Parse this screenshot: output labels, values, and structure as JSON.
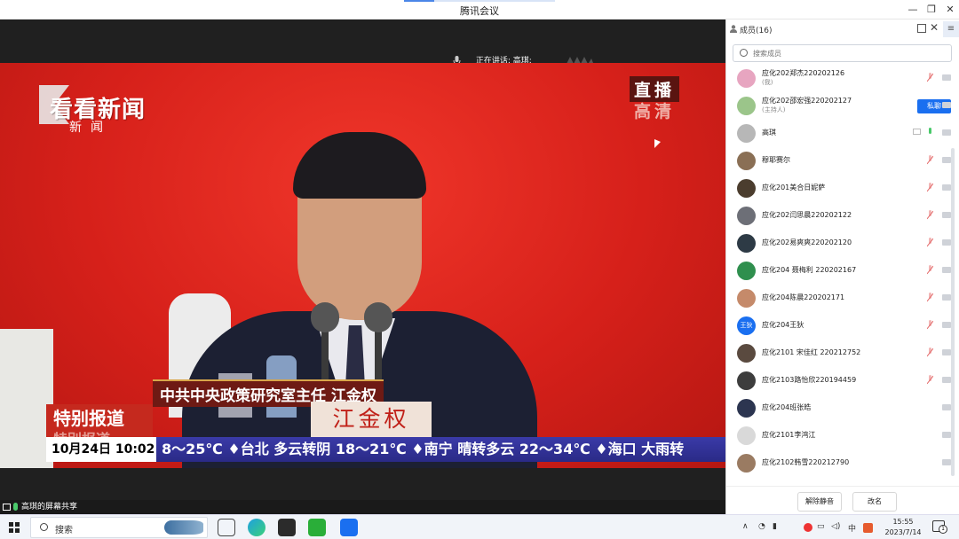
{
  "window": {
    "title": "腾讯会议"
  },
  "video": {
    "speaking_text": "正在讲话: 高琪;",
    "screen_share_label": "高琪的屏幕共享"
  },
  "broadcast": {
    "logo_main": "看看新闻",
    "logo_sub": "新闻",
    "live_label": "直播",
    "hd_label": "高清",
    "caption": "中共中央政策研究室主任 江金权",
    "special_report": "特别报道",
    "special_report_shadow": "特别报道",
    "nameplate": "江金权",
    "ticker_date": "10月24日 10:02",
    "ticker_text": "8～25℃ ♦台北 多云转阴 18～21℃ ♦南宁 晴转多云 22～34℃ ♦海口 大雨转"
  },
  "members_panel": {
    "title": "成员(16)",
    "search_placeholder": "搜索成员",
    "private_chat_label": "私聊",
    "members": [
      {
        "name": "应化202郑杰220202126",
        "role": "(我)",
        "avatar_color": "#e7a5c0",
        "avatar_text": "",
        "mic": "muted",
        "share": false
      },
      {
        "name": "应化202邵宏强220202127",
        "role": "(主持人)",
        "avatar_color": "#9bc58a",
        "avatar_text": "",
        "mic": "none",
        "share": false,
        "private_chat": true
      },
      {
        "name": "高琪",
        "role": "",
        "avatar_color": "#b7b7b7",
        "avatar_text": "",
        "mic": "active",
        "share": true
      },
      {
        "name": "穆耶赛尔",
        "role": "",
        "avatar_color": "#8a6f55",
        "avatar_text": "",
        "mic": "muted",
        "share": false
      },
      {
        "name": "应化201美合日妮萨",
        "role": "",
        "avatar_color": "#4b3d2e",
        "avatar_text": "",
        "mic": "muted",
        "share": false
      },
      {
        "name": "应化202闫思晨220202122",
        "role": "",
        "avatar_color": "#6d6f77",
        "avatar_text": "",
        "mic": "muted",
        "share": false
      },
      {
        "name": "应化202易爽爽220202120",
        "role": "",
        "avatar_color": "#2d3a45",
        "avatar_text": "",
        "mic": "muted",
        "share": false
      },
      {
        "name": "应化204 聂梅利 220202167",
        "role": "",
        "avatar_color": "#2f8f4e",
        "avatar_text": "",
        "mic": "muted",
        "share": false
      },
      {
        "name": "应化204陈晨220202171",
        "role": "",
        "avatar_color": "#c58a6a",
        "avatar_text": "",
        "mic": "muted",
        "share": false
      },
      {
        "name": "应化204王狄",
        "role": "",
        "avatar_color": "#1a6ff0",
        "avatar_text": "王狄",
        "mic": "muted",
        "share": false
      },
      {
        "name": "应化2101 宋佳红 220212752",
        "role": "",
        "avatar_color": "#5a4a3f",
        "avatar_text": "",
        "mic": "muted",
        "share": false
      },
      {
        "name": "应化2103路怡欣220194459",
        "role": "",
        "avatar_color": "#3d3d3d",
        "avatar_text": "",
        "mic": "muted",
        "share": false
      },
      {
        "name": "应化204班张皓",
        "role": "",
        "avatar_color": "#2c3550",
        "avatar_text": "",
        "mic": "none",
        "share": false
      },
      {
        "name": "应化2101李鸿江",
        "role": "",
        "avatar_color": "#d9d9d9",
        "avatar_text": "",
        "mic": "none",
        "share": false
      },
      {
        "name": "应化2102韩雪220212790",
        "role": "",
        "avatar_color": "#9a7b62",
        "avatar_text": "",
        "mic": "none",
        "share": false
      }
    ],
    "unmute_all_label": "解除静音",
    "rename_label": "改名"
  },
  "taskbar": {
    "search_label": "搜索",
    "time": "15:55",
    "date": "2023/7/14",
    "notification_count": "1"
  },
  "colors": {
    "accent": "#1a6ff0",
    "muted_mic": "#e36a6a",
    "active_mic": "#49c96a",
    "stage_red": "#d6201a"
  }
}
